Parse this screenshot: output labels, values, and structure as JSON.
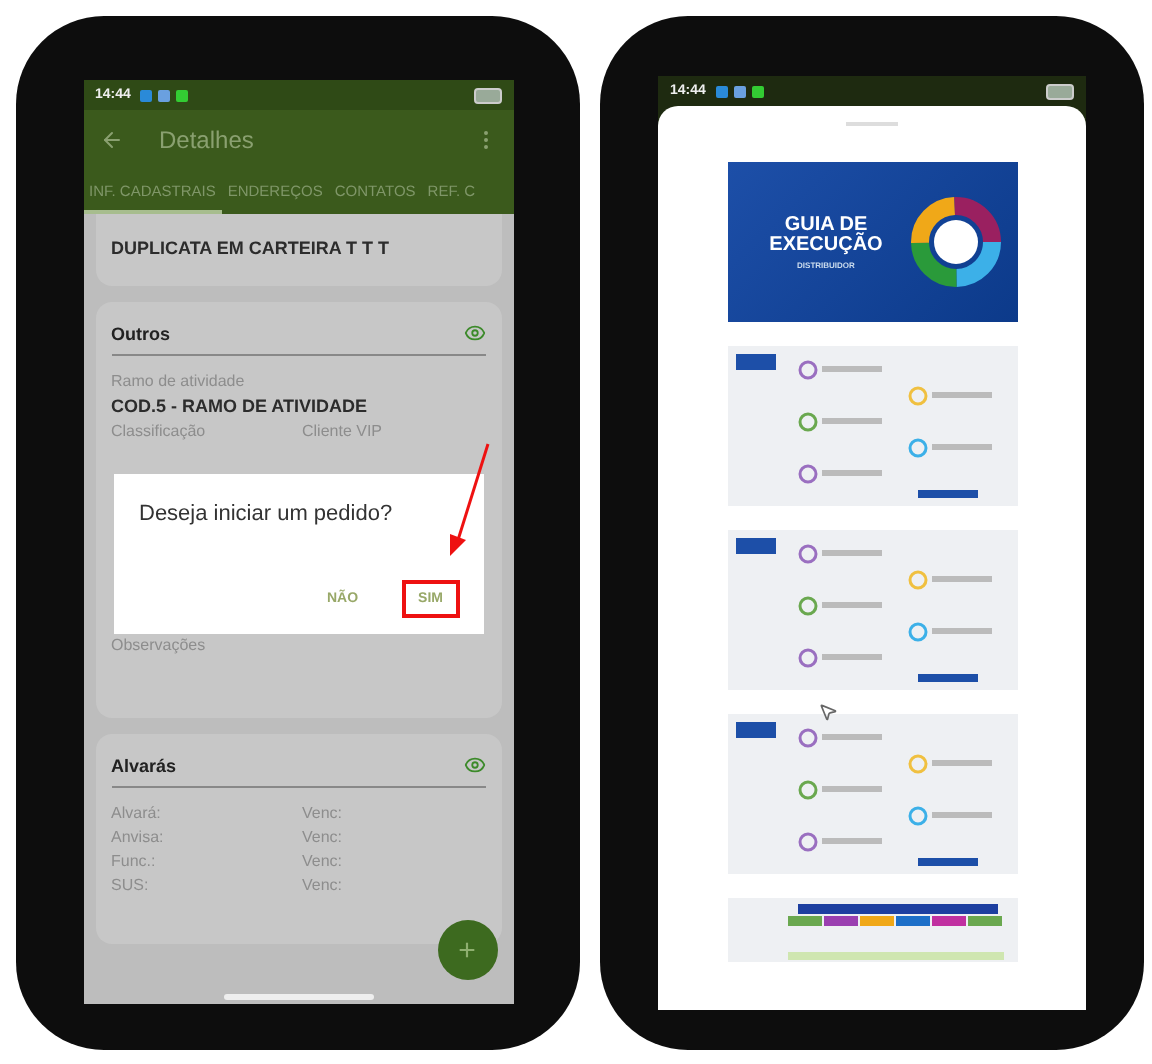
{
  "left_phone": {
    "status_time": "14:44",
    "app_bar": {
      "title": "Detalhes"
    },
    "tabs": [
      {
        "label": "INF. CADASTRAIS",
        "selected": true
      },
      {
        "label": "ENDEREÇOS",
        "selected": false
      },
      {
        "label": "CONTATOS",
        "selected": false
      },
      {
        "label": "REF. C",
        "selected": false
      }
    ],
    "billing_value": "DUPLICATA EM CARTEIRA T T T",
    "outros": {
      "title": "Outros",
      "activity_label": "Ramo de atividade",
      "activity_value": "COD.5 - RAMO DE ATIVIDADE",
      "column_labels": [
        "Classificação",
        "Cliente VIP"
      ],
      "notes_label": "Observações"
    },
    "alvaras": {
      "title": "Alvarás",
      "rows": [
        {
          "label": "Alvará:",
          "due": "Venc:"
        },
        {
          "label": "Anvisa:",
          "due": "Venc:"
        },
        {
          "label": "Func.:",
          "due": "Venc:"
        },
        {
          "label": "SUS:",
          "due": "Venc:"
        }
      ]
    },
    "fab": "+",
    "dialog": {
      "message": "Deseja iniciar um pedido?",
      "buttons": [
        {
          "label": "NÃO",
          "highlighted": false
        },
        {
          "label": "SIM",
          "highlighted": true
        }
      ]
    }
  },
  "right_phone": {
    "status_time": "14:44",
    "pages": [
      {
        "kind": "cover",
        "title": [
          "GUIA DE",
          "EXECUÇÃO"
        ],
        "subtitle": "DISTRIBUIDOR"
      },
      {
        "kind": "infographic"
      },
      {
        "kind": "infographic"
      },
      {
        "kind": "infographic"
      },
      {
        "kind": "table"
      }
    ]
  }
}
